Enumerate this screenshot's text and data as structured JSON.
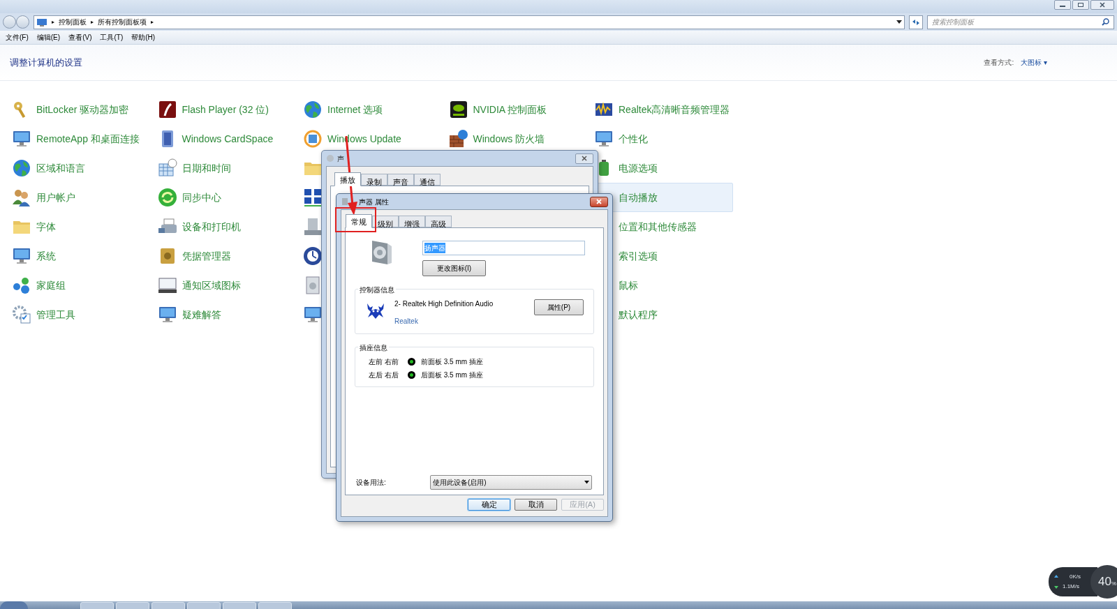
{
  "address_bar": {
    "breadcrumbs": [
      "控制面板",
      "所有控制面板项"
    ],
    "separator": "▸",
    "search_placeholder": "搜索控制面板"
  },
  "menu_bar": [
    "文件(F)",
    "编辑(E)",
    "查看(V)",
    "工具(T)",
    "帮助(H)"
  ],
  "header": {
    "title": "调整计算机的设置",
    "view_label": "查看方式:",
    "view_value": "大图标",
    "view_caret": "▾"
  },
  "columns": [
    {
      "items": [
        {
          "kind": "link",
          "label": "BitLocker 驱动器加密",
          "highlighted": false
        },
        {
          "kind": "link",
          "label": "RemoteApp 和桌面连接",
          "highlighted": false
        },
        {
          "kind": "link",
          "label": "区域和语言",
          "highlighted": false
        },
        {
          "kind": "link",
          "label": "用户帐户",
          "highlighted": false
        },
        {
          "kind": "link",
          "label": "字体",
          "highlighted": false
        },
        {
          "kind": "link",
          "label": "系统",
          "highlighted": false
        },
        {
          "kind": "link",
          "label": "家庭组",
          "highlighted": false
        },
        {
          "kind": "link",
          "label": "管理工具",
          "highlighted": false
        }
      ]
    },
    {
      "items": [
        {
          "kind": "link",
          "label": "Flash Player (32 位)",
          "highlighted": false
        },
        {
          "kind": "link",
          "label": "Windows CardSpace",
          "highlighted": false
        },
        {
          "kind": "link",
          "label": "日期和时间",
          "highlighted": false
        },
        {
          "kind": "link",
          "label": "同步中心",
          "highlighted": false
        },
        {
          "kind": "link",
          "label": "设备和打印机",
          "highlighted": false
        },
        {
          "kind": "link",
          "label": "凭据管理器",
          "highlighted": false
        },
        {
          "kind": "link",
          "label": "通知区域图标",
          "highlighted": false
        },
        {
          "kind": "link",
          "label": "疑难解答",
          "highlighted": false
        }
      ]
    },
    {
      "items": [
        {
          "kind": "link",
          "label": "Internet 选项",
          "highlighted": false
        },
        {
          "kind": "link",
          "label": "Windows Update",
          "highlighted": false
        },
        {
          "kind": "icon"
        },
        {
          "kind": "icon"
        },
        {
          "kind": "icon"
        },
        {
          "kind": "icon"
        },
        {
          "kind": "icon"
        },
        {
          "kind": "icon"
        }
      ]
    },
    {
      "items": [
        {
          "kind": "link",
          "label": "NVIDIA 控制面板",
          "highlighted": false
        },
        {
          "kind": "link",
          "label": "Windows 防火墙",
          "highlighted": false
        }
      ]
    },
    {
      "items": [
        {
          "kind": "link",
          "label": "Realtek高清晰音频管理器",
          "highlighted": false
        },
        {
          "kind": "link",
          "label": "个性化",
          "highlighted": false
        },
        {
          "kind": "link",
          "label": "电源选项",
          "highlighted": false
        },
        {
          "kind": "label",
          "label": "自动播放",
          "highlighted": true
        },
        {
          "kind": "label",
          "label": "位置和其他传感器",
          "highlighted": false
        },
        {
          "kind": "label",
          "label": "索引选项",
          "highlighted": false
        },
        {
          "kind": "label",
          "label": "鼠标",
          "highlighted": false
        },
        {
          "kind": "label",
          "label": "默认程序",
          "highlighted": false
        }
      ]
    }
  ],
  "sound_dialog": {
    "title": "声",
    "tabs": [
      {
        "label": "播放",
        "selected": true
      },
      {
        "label": "录制",
        "selected": false
      },
      {
        "label": "声音",
        "selected": false
      },
      {
        "label": "通信",
        "selected": false
      }
    ]
  },
  "properties_dialog": {
    "title": "声器 属性",
    "tabs": [
      {
        "label": "常规",
        "selected": true
      },
      {
        "label": "级别",
        "selected": false
      },
      {
        "label": "增强",
        "selected": false
      },
      {
        "label": "高级",
        "selected": false
      }
    ],
    "name_field": {
      "value": "扬声器",
      "text_selected": true
    },
    "change_icon_button": "更改图标(I)",
    "controller": {
      "group_title": "控制器信息",
      "name": "2- Realtek High Definition Audio",
      "vendor": "Realtek",
      "properties_button": "属性(P)"
    },
    "jacks": {
      "group_title": "插座信息",
      "rows": [
        {
          "channels": "左前 右前",
          "color": "#22b822",
          "description": "前面板 3.5 mm 插座"
        },
        {
          "channels": "左后 右后",
          "color": "#22b822",
          "description": "后面板 3.5 mm 插座"
        }
      ]
    },
    "usage": {
      "label": "设备用法:",
      "value": "使用此设备(启用)"
    },
    "buttons": [
      {
        "label": "确定",
        "default": true,
        "disabled": false
      },
      {
        "label": "取消",
        "default": false,
        "disabled": false
      },
      {
        "label": "应用(A)",
        "default": false,
        "disabled": true
      }
    ]
  },
  "net_meter": {
    "upload": "0K/s",
    "download": "1.1M/s",
    "value": "40",
    "unit": "%"
  }
}
